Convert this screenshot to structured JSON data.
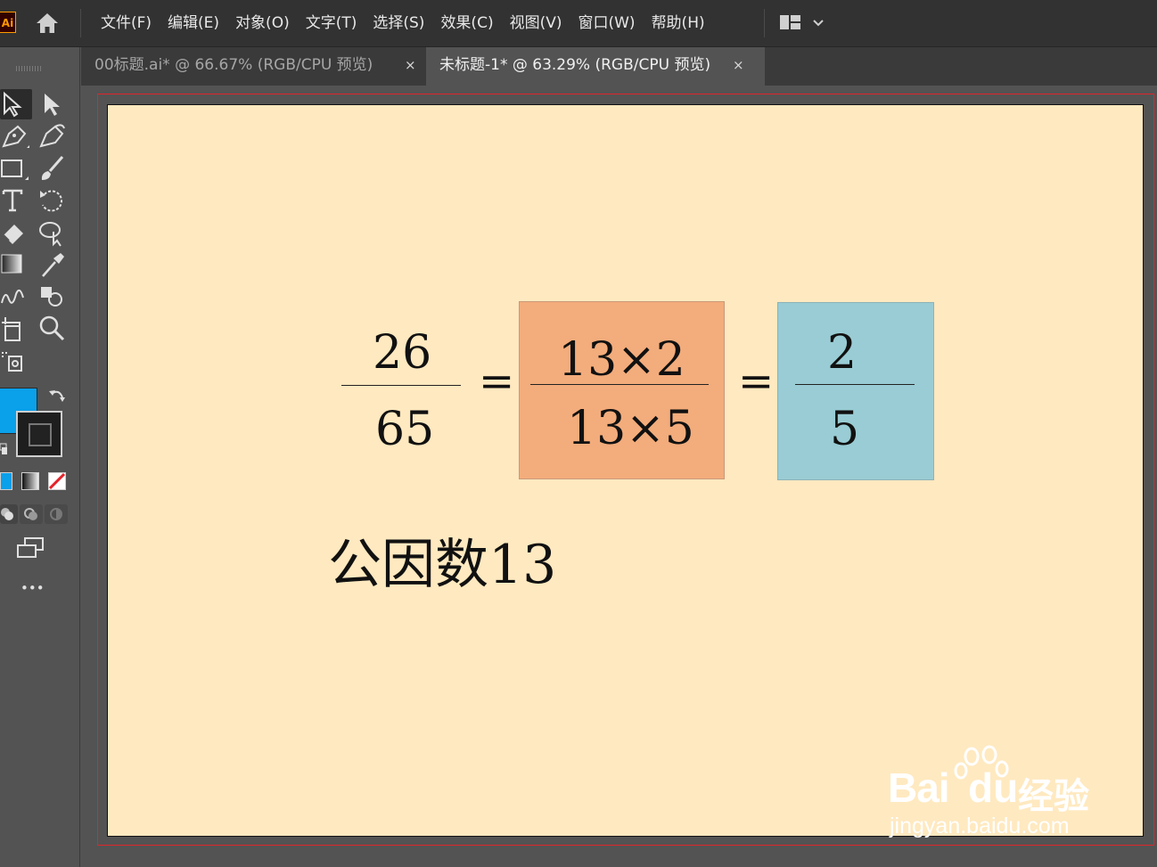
{
  "app": {
    "logo_text": "Ai"
  },
  "menu": [
    "文件(F)",
    "编辑(E)",
    "对象(O)",
    "文字(T)",
    "选择(S)",
    "效果(C)",
    "视图(V)",
    "窗口(W)",
    "帮助(H)"
  ],
  "tabs": [
    {
      "label": "00标题.ai* @ 66.67% (RGB/CPU 预览)",
      "close": "×",
      "active": false
    },
    {
      "label": "未标题-1* @ 63.29% (RGB/CPU 预览)",
      "close": "×",
      "active": true
    }
  ],
  "colors": {
    "fill": "#0aa0ea",
    "stroke": "#1e1e1e",
    "artboard": "#ffe9c0",
    "box_orange": "#f3ac7b",
    "box_blue": "#99ccd4",
    "bleed": "#e0252a"
  },
  "artwork": {
    "frac1": {
      "numerator": "26",
      "denominator": "65"
    },
    "eq1": "=",
    "frac2": {
      "numerator": "13×2",
      "denominator": "13×5"
    },
    "eq2": "=",
    "frac3": {
      "numerator": "2",
      "denominator": "5"
    },
    "note": "公因数13"
  },
  "toolbar": {
    "more": "•••"
  },
  "watermark": {
    "brand": "Bai",
    "brand2": "du",
    "cn": "经验",
    "url": "jingyan.baidu.com"
  }
}
